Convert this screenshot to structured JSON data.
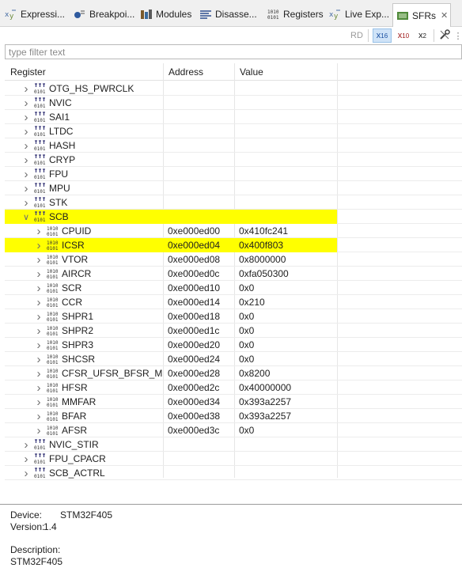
{
  "tabs": [
    {
      "label": "Expressi...",
      "icon": "expressions-icon"
    },
    {
      "label": "Breakpoi...",
      "icon": "breakpoints-icon"
    },
    {
      "label": "Modules",
      "icon": "modules-icon"
    },
    {
      "label": "Disasse...",
      "icon": "disassembly-icon"
    },
    {
      "label": "Registers",
      "icon": "registers-icon"
    },
    {
      "label": "Live Exp...",
      "icon": "live-expressions-icon"
    },
    {
      "label": "SFRs",
      "icon": "sfrs-icon",
      "close": "✕"
    }
  ],
  "toolbar": {
    "rd": "RD",
    "hex_base": "x",
    "hex_sub": "16",
    "dec_base": "x",
    "dec_sub": "10",
    "bin_base": "x",
    "bin_sub": "2",
    "more": "⋮"
  },
  "filter": {
    "placeholder": "type filter text"
  },
  "columns": {
    "register": "Register",
    "address": "Address",
    "value": "Value"
  },
  "colors": {
    "highlight": "#ffff00",
    "peripheral_icon": "#3a3a7a",
    "register_icon": "#3a3a3a"
  },
  "rows": [
    {
      "name": "OTG_HS_PWRCLK",
      "address": "",
      "value": "",
      "level": 1,
      "expanded": false,
      "highlighted": false
    },
    {
      "name": "NVIC",
      "address": "",
      "value": "",
      "level": 1,
      "expanded": false,
      "highlighted": false
    },
    {
      "name": "SAI1",
      "address": "",
      "value": "",
      "level": 1,
      "expanded": false,
      "highlighted": false
    },
    {
      "name": "LTDC",
      "address": "",
      "value": "",
      "level": 1,
      "expanded": false,
      "highlighted": false
    },
    {
      "name": "HASH",
      "address": "",
      "value": "",
      "level": 1,
      "expanded": false,
      "highlighted": false
    },
    {
      "name": "CRYP",
      "address": "",
      "value": "",
      "level": 1,
      "expanded": false,
      "highlighted": false
    },
    {
      "name": "FPU",
      "address": "",
      "value": "",
      "level": 1,
      "expanded": false,
      "highlighted": false
    },
    {
      "name": "MPU",
      "address": "",
      "value": "",
      "level": 1,
      "expanded": false,
      "highlighted": false
    },
    {
      "name": "STK",
      "address": "",
      "value": "",
      "level": 1,
      "expanded": false,
      "highlighted": false
    },
    {
      "name": "SCB",
      "address": "",
      "value": "",
      "level": 1,
      "expanded": true,
      "highlighted": true
    },
    {
      "name": "CPUID",
      "address": "0xe000ed00",
      "value": "0x410fc241",
      "level": 2,
      "expanded": false,
      "highlighted": false
    },
    {
      "name": "ICSR",
      "address": "0xe000ed04",
      "value": "0x400f803",
      "level": 2,
      "expanded": false,
      "highlighted": true
    },
    {
      "name": "VTOR",
      "address": "0xe000ed08",
      "value": "0x8000000",
      "level": 2,
      "expanded": false,
      "highlighted": false
    },
    {
      "name": "AIRCR",
      "address": "0xe000ed0c",
      "value": "0xfa050300",
      "level": 2,
      "expanded": false,
      "highlighted": false
    },
    {
      "name": "SCR",
      "address": "0xe000ed10",
      "value": "0x0",
      "level": 2,
      "expanded": false,
      "highlighted": false
    },
    {
      "name": "CCR",
      "address": "0xe000ed14",
      "value": "0x210",
      "level": 2,
      "expanded": false,
      "highlighted": false
    },
    {
      "name": "SHPR1",
      "address": "0xe000ed18",
      "value": "0x0",
      "level": 2,
      "expanded": false,
      "highlighted": false
    },
    {
      "name": "SHPR2",
      "address": "0xe000ed1c",
      "value": "0x0",
      "level": 2,
      "expanded": false,
      "highlighted": false
    },
    {
      "name": "SHPR3",
      "address": "0xe000ed20",
      "value": "0x0",
      "level": 2,
      "expanded": false,
      "highlighted": false
    },
    {
      "name": "SHCSR",
      "address": "0xe000ed24",
      "value": "0x0",
      "level": 2,
      "expanded": false,
      "highlighted": false
    },
    {
      "name": "CFSR_UFSR_BFSR_MMFSR",
      "address": "0xe000ed28",
      "value": "0x8200",
      "level": 2,
      "expanded": false,
      "highlighted": false
    },
    {
      "name": "HFSR",
      "address": "0xe000ed2c",
      "value": "0x40000000",
      "level": 2,
      "expanded": false,
      "highlighted": false
    },
    {
      "name": "MMFAR",
      "address": "0xe000ed34",
      "value": "0x393a2257",
      "level": 2,
      "expanded": false,
      "highlighted": false
    },
    {
      "name": "BFAR",
      "address": "0xe000ed38",
      "value": "0x393a2257",
      "level": 2,
      "expanded": false,
      "highlighted": false
    },
    {
      "name": "AFSR",
      "address": "0xe000ed3c",
      "value": "0x0",
      "level": 2,
      "expanded": false,
      "highlighted": false
    },
    {
      "name": "NVIC_STIR",
      "address": "",
      "value": "",
      "level": 1,
      "expanded": false,
      "highlighted": false
    },
    {
      "name": "FPU_CPACR",
      "address": "",
      "value": "",
      "level": 1,
      "expanded": false,
      "highlighted": false
    },
    {
      "name": "SCB_ACTRL",
      "address": "",
      "value": "",
      "level": 1,
      "expanded": false,
      "highlighted": false
    }
  ],
  "details": {
    "device_label": "Device:",
    "device_value": "STM32F405",
    "version_label": "Version:",
    "version_value": "1.4",
    "description_label": "Description:",
    "description_value": "STM32F405"
  }
}
